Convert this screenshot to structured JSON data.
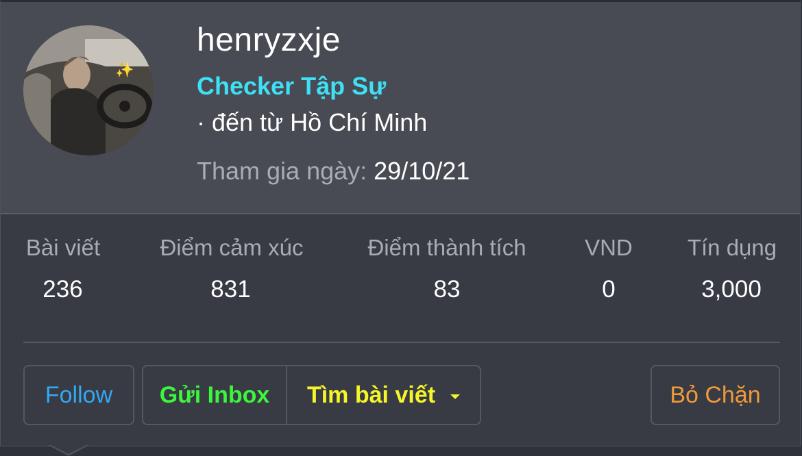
{
  "profile": {
    "username": "henryzxje",
    "rank": "Checker Tập Sự",
    "location": "· đến từ Hồ Chí Minh",
    "joined_label": "Tham gia ngày:",
    "joined_value": "29/10/21",
    "avatar_sparkle": "✨"
  },
  "stats": [
    {
      "label": "Bài viết",
      "value": "236"
    },
    {
      "label": "Điểm cảm xúc",
      "value": "831"
    },
    {
      "label": "Điểm thành tích",
      "value": "83"
    },
    {
      "label": "VND",
      "value": "0"
    },
    {
      "label": "Tín dụng",
      "value": "3,000"
    }
  ],
  "actions": {
    "follow": "Follow",
    "inbox": "Gửi Inbox",
    "find_posts": "Tìm bài viết",
    "unblock": "Bỏ Chặn"
  },
  "colors": {
    "rank": "#3ee0f5",
    "follow": "#33a8f4",
    "inbox": "#3df53d",
    "find_posts": "#f5f52a",
    "unblock": "#f09a3a"
  }
}
